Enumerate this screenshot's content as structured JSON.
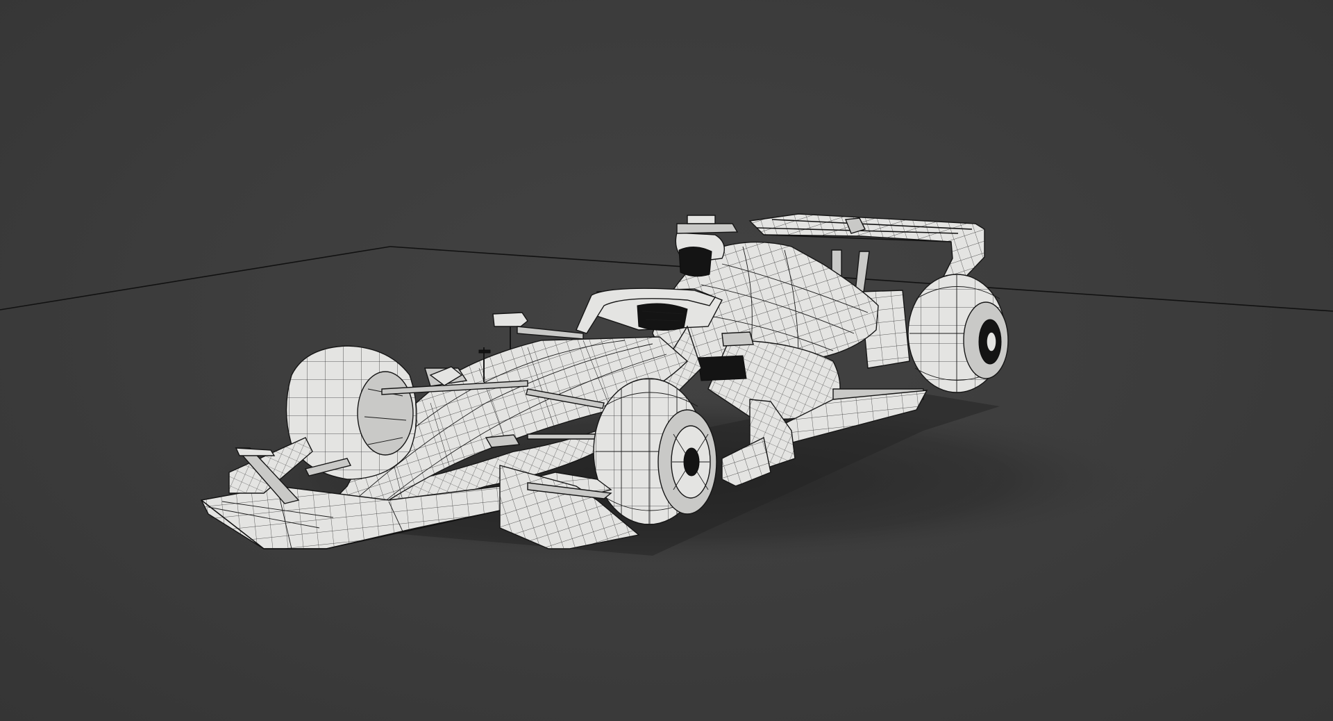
{
  "scene": {
    "background_color": "#3b3b3b",
    "model_fill_color": "#e4e4e2",
    "wireframe_color": "#1a1a1a",
    "ground_line_color": "#111111",
    "subject": "wireframe-race-car-model"
  }
}
